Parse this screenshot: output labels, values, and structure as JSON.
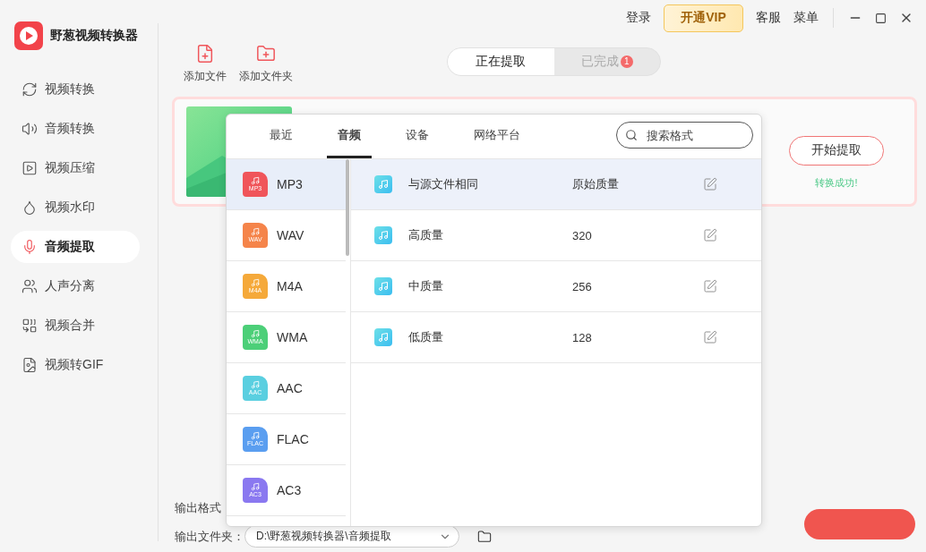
{
  "app": {
    "title": "野葱视频转换器"
  },
  "nav": [
    {
      "label": "视频转换",
      "selected": false
    },
    {
      "label": "音频转换",
      "selected": false
    },
    {
      "label": "视频压缩",
      "selected": false
    },
    {
      "label": "视频水印",
      "selected": false
    },
    {
      "label": "音频提取",
      "selected": true
    },
    {
      "label": "人声分离",
      "selected": false
    },
    {
      "label": "视频合并",
      "selected": false
    },
    {
      "label": "视频转GIF",
      "selected": false
    }
  ],
  "header": {
    "login": "登录",
    "vip": "开通VIP",
    "service": "客服",
    "menu": "菜单"
  },
  "toolbar": [
    {
      "kind": "file",
      "label": "添加文件"
    },
    {
      "kind": "folder",
      "label": "添加文件夹"
    }
  ],
  "status_tabs": [
    {
      "label": "正在提取",
      "selected": true
    },
    {
      "label": "已完成",
      "selected": false,
      "badge": "1"
    }
  ],
  "task": {
    "button": "开始提取",
    "status": "转换成功!"
  },
  "format_picker": {
    "tabs": [
      {
        "label": "最近",
        "selected": false
      },
      {
        "label": "音频",
        "selected": true
      },
      {
        "label": "设备",
        "selected": false
      },
      {
        "label": "网络平台",
        "selected": false
      }
    ],
    "search": {
      "placeholder": "搜索格式"
    },
    "formats": [
      {
        "name": "MP3",
        "badge": "MP3",
        "color": "#f0555a",
        "selected": true
      },
      {
        "name": "WAV",
        "badge": "WAV",
        "color": "#f5844a",
        "selected": false
      },
      {
        "name": "M4A",
        "badge": "M4A",
        "color": "#f5a93a",
        "selected": false
      },
      {
        "name": "WMA",
        "badge": "WMA",
        "color": "#4ccf78",
        "selected": false
      },
      {
        "name": "AAC",
        "badge": "AAC",
        "color": "#5acfe0",
        "selected": false
      },
      {
        "name": "FLAC",
        "badge": "FLAC",
        "color": "#5a9ef0",
        "selected": false
      },
      {
        "name": "AC3",
        "badge": "AC3",
        "color": "#8a78f0",
        "selected": false
      }
    ],
    "presets": [
      {
        "name": "与源文件相同",
        "quality": "原始质量",
        "selected": true
      },
      {
        "name": "高质量",
        "quality": "320",
        "selected": false
      },
      {
        "name": "中质量",
        "quality": "256",
        "selected": false
      },
      {
        "name": "低质量",
        "quality": "128",
        "selected": false
      }
    ]
  },
  "output": {
    "format_label": "输出格式",
    "folder_label": "输出文件夹：",
    "folder": "D:\\野葱视频转换器\\音频提取"
  }
}
